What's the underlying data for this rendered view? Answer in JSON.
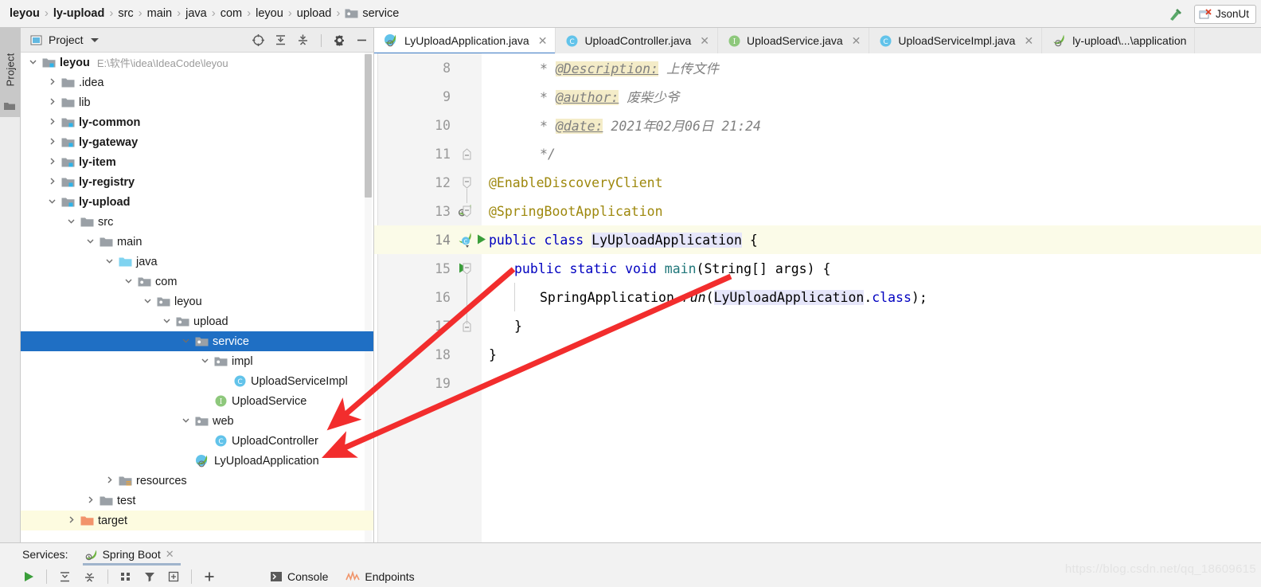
{
  "breadcrumb": {
    "items": [
      {
        "label": "leyou",
        "bold": true,
        "icon": ""
      },
      {
        "label": "ly-upload",
        "bold": true,
        "icon": ""
      },
      {
        "label": "src",
        "bold": false,
        "icon": ""
      },
      {
        "label": "main",
        "bold": false,
        "icon": ""
      },
      {
        "label": "java",
        "bold": false,
        "icon": ""
      },
      {
        "label": "com",
        "bold": false,
        "icon": ""
      },
      {
        "label": "leyou",
        "bold": false,
        "icon": ""
      },
      {
        "label": "upload",
        "bold": false,
        "icon": ""
      },
      {
        "label": "service",
        "bold": false,
        "icon": "package-icon"
      }
    ],
    "separator": "›"
  },
  "navbar_right": {
    "build_icon": "hammer-icon",
    "run_config_label": "JsonUt",
    "run_config_icon": "broken-config-icon"
  },
  "toolstrip": {
    "project_tab_label": "Project",
    "project_tab_icon": "folder-icon"
  },
  "project_panel": {
    "title": "Project",
    "title_icon": "project-module-icon",
    "dropdown_icon": "chevron-down-icon",
    "actions": [
      {
        "name": "select-opened-file-icon",
        "label": ""
      },
      {
        "name": "expand-all-icon",
        "label": ""
      },
      {
        "name": "collapse-all-icon",
        "label": ""
      },
      {
        "name": "settings-gear-icon",
        "label": ""
      },
      {
        "name": "hide-panel-icon",
        "label": ""
      }
    ],
    "tree": [
      {
        "label": "leyou",
        "path": "E:\\软件\\idea\\IdeaCode\\leyou",
        "depth": 0,
        "arrow": "down",
        "icon": "module-folder-icon",
        "bold": true,
        "state": "normal"
      },
      {
        "label": ".idea",
        "path": "",
        "depth": 1,
        "arrow": "right",
        "icon": "folder-icon",
        "bold": false,
        "state": "normal"
      },
      {
        "label": "lib",
        "path": "",
        "depth": 1,
        "arrow": "right",
        "icon": "folder-icon",
        "bold": false,
        "state": "normal"
      },
      {
        "label": "ly-common",
        "path": "",
        "depth": 1,
        "arrow": "right",
        "icon": "module-folder-icon",
        "bold": true,
        "state": "normal"
      },
      {
        "label": "ly-gateway",
        "path": "",
        "depth": 1,
        "arrow": "right",
        "icon": "module-folder-icon",
        "bold": true,
        "state": "normal"
      },
      {
        "label": "ly-item",
        "path": "",
        "depth": 1,
        "arrow": "right",
        "icon": "module-folder-icon",
        "bold": true,
        "state": "normal"
      },
      {
        "label": "ly-registry",
        "path": "",
        "depth": 1,
        "arrow": "right",
        "icon": "module-folder-icon",
        "bold": true,
        "state": "normal"
      },
      {
        "label": "ly-upload",
        "path": "",
        "depth": 1,
        "arrow": "down",
        "icon": "module-folder-icon",
        "bold": true,
        "state": "normal"
      },
      {
        "label": "src",
        "path": "",
        "depth": 2,
        "arrow": "down",
        "icon": "folder-icon",
        "bold": false,
        "state": "normal"
      },
      {
        "label": "main",
        "path": "",
        "depth": 3,
        "arrow": "down",
        "icon": "folder-icon",
        "bold": false,
        "state": "normal"
      },
      {
        "label": "java",
        "path": "",
        "depth": 4,
        "arrow": "down",
        "icon": "source-folder-icon",
        "bold": false,
        "state": "normal"
      },
      {
        "label": "com",
        "path": "",
        "depth": 5,
        "arrow": "down",
        "icon": "package-icon",
        "bold": false,
        "state": "normal"
      },
      {
        "label": "leyou",
        "path": "",
        "depth": 6,
        "arrow": "down",
        "icon": "package-icon",
        "bold": false,
        "state": "normal"
      },
      {
        "label": "upload",
        "path": "",
        "depth": 7,
        "arrow": "down",
        "icon": "package-icon",
        "bold": false,
        "state": "normal"
      },
      {
        "label": "service",
        "path": "",
        "depth": 8,
        "arrow": "down",
        "icon": "package-icon",
        "bold": false,
        "state": "selected"
      },
      {
        "label": "impl",
        "path": "",
        "depth": 9,
        "arrow": "down",
        "icon": "package-icon",
        "bold": false,
        "state": "normal"
      },
      {
        "label": "UploadServiceImpl",
        "path": "",
        "depth": 10,
        "arrow": "none",
        "icon": "class-icon",
        "bold": false,
        "state": "normal"
      },
      {
        "label": "UploadService",
        "path": "",
        "depth": 9,
        "arrow": "none",
        "icon": "interface-icon",
        "bold": false,
        "state": "normal"
      },
      {
        "label": "web",
        "path": "",
        "depth": 8,
        "arrow": "down",
        "icon": "package-icon",
        "bold": false,
        "state": "normal"
      },
      {
        "label": "UploadController",
        "path": "",
        "depth": 9,
        "arrow": "none",
        "icon": "class-icon",
        "bold": false,
        "state": "normal"
      },
      {
        "label": "LyUploadApplication",
        "path": "",
        "depth": 8,
        "arrow": "none",
        "icon": "spring-class-icon",
        "bold": false,
        "state": "normal"
      },
      {
        "label": "resources",
        "path": "",
        "depth": 4,
        "arrow": "right",
        "icon": "resources-folder-icon",
        "bold": false,
        "state": "normal"
      },
      {
        "label": "test",
        "path": "",
        "depth": 3,
        "arrow": "right",
        "icon": "folder-icon",
        "bold": false,
        "state": "normal"
      },
      {
        "label": "target",
        "path": "",
        "depth": 2,
        "arrow": "right",
        "icon": "target-folder-icon",
        "bold": false,
        "state": "highlight"
      }
    ]
  },
  "editor": {
    "tabs": [
      {
        "label": "LyUploadApplication.java",
        "icon": "spring-class-icon",
        "active": true,
        "closable": true
      },
      {
        "label": "UploadController.java",
        "icon": "class-icon",
        "active": false,
        "closable": true
      },
      {
        "label": "UploadService.java",
        "icon": "interface-icon",
        "active": false,
        "closable": true
      },
      {
        "label": "UploadServiceImpl.java",
        "icon": "class-icon",
        "active": false,
        "closable": true
      },
      {
        "label": "ly-upload\\...\\application",
        "icon": "spring-yaml-icon",
        "active": false,
        "closable": false
      }
    ],
    "lines": [
      {
        "no": "8",
        "indent": 2,
        "highlight": false,
        "gutter": "",
        "fold": "none",
        "segments": [
          {
            "t": "* ",
            "c": "cmt"
          },
          {
            "t": "@Description:",
            "c": "cmtt"
          },
          {
            "t": " 上传文件",
            "c": "cmt"
          }
        ]
      },
      {
        "no": "9",
        "indent": 2,
        "highlight": false,
        "gutter": "",
        "fold": "none",
        "segments": [
          {
            "t": "* ",
            "c": "cmt"
          },
          {
            "t": "@author:",
            "c": "cmtt"
          },
          {
            "t": " 废柴少爷",
            "c": "cmt"
          }
        ]
      },
      {
        "no": "10",
        "indent": 2,
        "highlight": false,
        "gutter": "",
        "fold": "none",
        "segments": [
          {
            "t": "* ",
            "c": "cmt"
          },
          {
            "t": "@date:",
            "c": "cmtt"
          },
          {
            "t": " 2021年02月06日 21:24",
            "c": "cmt"
          }
        ]
      },
      {
        "no": "11",
        "indent": 2,
        "highlight": false,
        "gutter": "",
        "fold": "end",
        "segments": [
          {
            "t": "*/",
            "c": "cmt"
          }
        ]
      },
      {
        "no": "12",
        "indent": 0,
        "highlight": false,
        "gutter": "",
        "fold": "start",
        "segments": [
          {
            "t": "@EnableDiscoveryClient",
            "c": "ann"
          }
        ]
      },
      {
        "no": "13",
        "indent": 0,
        "highlight": false,
        "gutter": "spring-bean-icon",
        "fold": "start",
        "segments": [
          {
            "t": "@SpringBootApplication",
            "c": "ann"
          }
        ]
      },
      {
        "no": "14",
        "indent": 0,
        "highlight": true,
        "gutter": "spring-run-icon",
        "fold": "none",
        "segments": [
          {
            "t": "public ",
            "c": "kw"
          },
          {
            "t": "class ",
            "c": "kw"
          },
          {
            "t": "LyUploadApplication",
            "c": "sel"
          },
          {
            "t": " {",
            "c": "cls"
          }
        ]
      },
      {
        "no": "15",
        "indent": 1,
        "highlight": false,
        "gutter": "run-icon",
        "fold": "start",
        "segments": [
          {
            "t": "public ",
            "c": "kw"
          },
          {
            "t": "static ",
            "c": "kw"
          },
          {
            "t": "void ",
            "c": "kw"
          },
          {
            "t": "main",
            "c": "typ"
          },
          {
            "t": "(String[] args) {",
            "c": "cls"
          }
        ]
      },
      {
        "no": "16",
        "indent": 2,
        "highlight": false,
        "gutter": "",
        "fold": "none",
        "segments": [
          {
            "t": "SpringApplication.",
            "c": "cls"
          },
          {
            "t": "run",
            "c": "ital"
          },
          {
            "t": "(",
            "c": "cls"
          },
          {
            "t": "LyUploadApplication",
            "c": "sel"
          },
          {
            "t": ".",
            "c": "cls"
          },
          {
            "t": "class",
            "c": "kw"
          },
          {
            "t": ");",
            "c": "cls"
          }
        ]
      },
      {
        "no": "17",
        "indent": 1,
        "highlight": false,
        "gutter": "",
        "fold": "end",
        "segments": [
          {
            "t": "}",
            "c": "cls"
          }
        ]
      },
      {
        "no": "18",
        "indent": 0,
        "highlight": false,
        "gutter": "",
        "fold": "none",
        "segments": [
          {
            "t": "}",
            "c": "cls"
          }
        ]
      },
      {
        "no": "19",
        "indent": 0,
        "highlight": false,
        "gutter": "",
        "fold": "none",
        "segments": []
      }
    ]
  },
  "services": {
    "label": "Services:",
    "tab_label": "Spring Boot",
    "tab_icon": "spring-boot-icon",
    "toolbar": [
      {
        "name": "run-button",
        "icon": "run-green-triangle"
      },
      {
        "name": "expand-all-button",
        "icon": "expand-all-icon"
      },
      {
        "name": "collapse-all-button",
        "icon": "collapse-all-icon"
      },
      {
        "name": "group-button",
        "icon": "grid-icon"
      },
      {
        "name": "filter-button",
        "icon": "funnel-icon"
      },
      {
        "name": "add-tab-button",
        "icon": "add-box-icon"
      },
      {
        "name": "plus-button",
        "icon": "plus-icon"
      }
    ],
    "right_items": [
      {
        "label": "Console",
        "icon": "console-icon"
      },
      {
        "label": "Endpoints",
        "icon": "endpoints-icon"
      }
    ]
  },
  "watermark": "https://blog.csdn.net/qq_18609615",
  "colors": {
    "selection_blue": "#1f6fc4",
    "highlight_yellow": "#fdfbe0",
    "annotation_red": "#f22d2d",
    "accent_tab_underline": "#3a78c2",
    "keyword_blue": "#0000c0",
    "annotation_gold": "#9e880d"
  }
}
